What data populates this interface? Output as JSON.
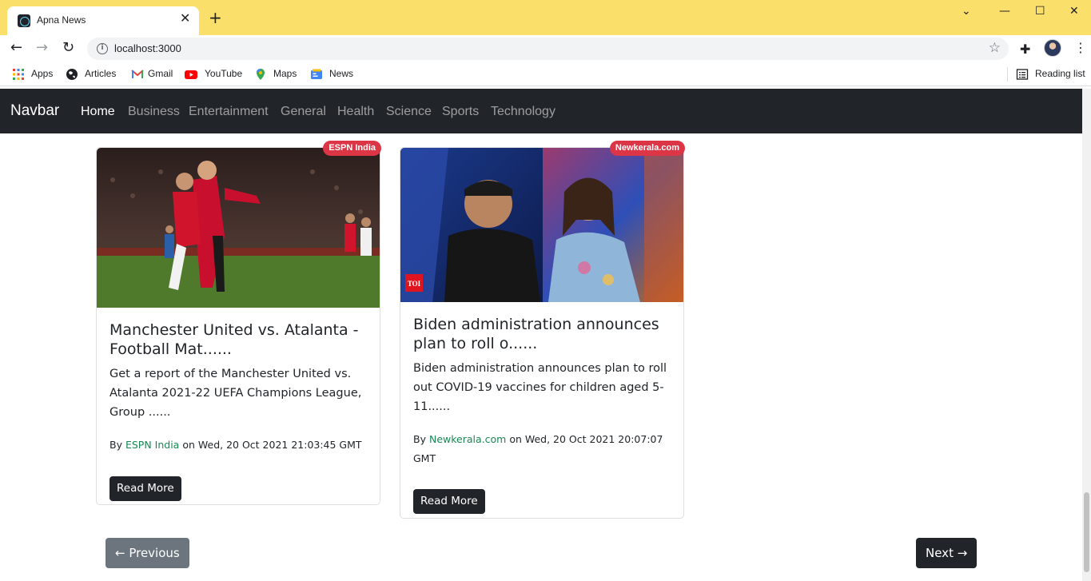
{
  "browser": {
    "tab_title": "Apna News",
    "url": "localhost:3000",
    "bookmarks": [
      "Apps",
      "Articles",
      "Gmail",
      "YouTube",
      "Maps",
      "News"
    ],
    "reading_list": "Reading list"
  },
  "navbar": {
    "brand": "Navbar",
    "links": [
      "Home",
      "Business",
      "Entertainment",
      "General",
      "Health",
      "Science",
      "Sports",
      "Technology"
    ]
  },
  "cards": [
    {
      "source": "ESPN India",
      "title_line1": "Manchester United vs. Atalanta -",
      "title_line2": "Football Mat......",
      "text_line1": "Get a report of the Manchester United vs.",
      "text_line2": "Atalanta 2021-22 UEFA Champions League,",
      "text_line3": "Group ......",
      "by": "By",
      "on_date": "on Wed, 20 Oct 2021 21:03:45 GMT",
      "button": "Read More"
    },
    {
      "source": "Newkerala.com",
      "title_line1": "Biden administration announces",
      "title_line2": "plan to roll o......",
      "text_line1": "Biden administration announces plan to roll",
      "text_line2": "out COVID-19 vaccines for children aged 5-",
      "text_line3": "11......",
      "by": "By",
      "on_date": "on Wed, 20 Oct 2021 20:07:07",
      "on_date2": "GMT",
      "button": "Read More",
      "image_logo": "TOI"
    }
  ],
  "pager": {
    "previous": "← Previous",
    "next": "Next →"
  }
}
